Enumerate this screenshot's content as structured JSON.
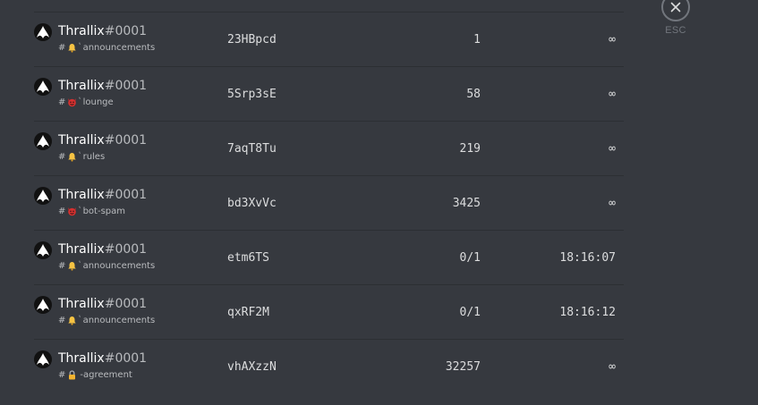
{
  "close": {
    "esc_label": "ESC"
  },
  "invites": [
    {
      "username": "Thrallix",
      "discriminator": "#0001",
      "channel_icon": "bell-icon",
      "channel_name": "announcements",
      "separator": "ʽ",
      "code": "23HBpcd",
      "uses": "1",
      "expires": "∞"
    },
    {
      "username": "Thrallix",
      "discriminator": "#0001",
      "channel_icon": "devil-face-icon",
      "channel_name": "lounge",
      "separator": "ʽ",
      "code": "5Srp3sE",
      "uses": "58",
      "expires": "∞"
    },
    {
      "username": "Thrallix",
      "discriminator": "#0001",
      "channel_icon": "bell-icon",
      "channel_name": "rules",
      "separator": "ʽ",
      "code": "7aqT8Tu",
      "uses": "219",
      "expires": "∞"
    },
    {
      "username": "Thrallix",
      "discriminator": "#0001",
      "channel_icon": "devil-face-icon",
      "channel_name": "bot-spam",
      "separator": "ʽ",
      "code": "bd3XvVc",
      "uses": "3425",
      "expires": "∞"
    },
    {
      "username": "Thrallix",
      "discriminator": "#0001",
      "channel_icon": "bell-icon",
      "channel_name": "announcements",
      "separator": "ʽ",
      "code": "etm6TS",
      "uses": "0/1",
      "expires": "18:16:07"
    },
    {
      "username": "Thrallix",
      "discriminator": "#0001",
      "channel_icon": "bell-icon",
      "channel_name": "announcements",
      "separator": "ʽ",
      "code": "qxRF2M",
      "uses": "0/1",
      "expires": "18:16:12"
    },
    {
      "username": "Thrallix",
      "discriminator": "#0001",
      "channel_icon": "lock-icon",
      "channel_name": "-agreement",
      "separator": "",
      "code": "vhAXzzN",
      "uses": "32257",
      "expires": "∞"
    }
  ]
}
